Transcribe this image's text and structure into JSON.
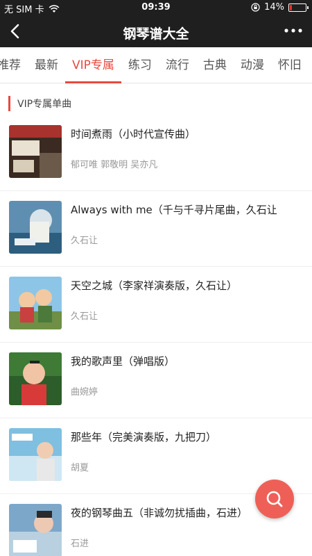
{
  "status_bar": {
    "carrier": "无 SIM 卡",
    "time": "09:39",
    "battery_text": "14%",
    "battery_level": 0.14,
    "battery_color": "#e33333"
  },
  "navbar": {
    "back_icon": "chevron-left-icon",
    "title": "钢琴谱大全",
    "more_icon": "more-horizontal-icon"
  },
  "tabs": [
    {
      "label": "推荐",
      "active": false
    },
    {
      "label": "最新",
      "active": false
    },
    {
      "label": "VIP专属",
      "active": true
    },
    {
      "label": "练习",
      "active": false
    },
    {
      "label": "流行",
      "active": false
    },
    {
      "label": "古典",
      "active": false
    },
    {
      "label": "动漫",
      "active": false
    },
    {
      "label": "怀旧",
      "active": false
    }
  ],
  "section": {
    "title": "VIP专属单曲"
  },
  "songs": [
    {
      "title": "时间煮雨（小时代宣传曲）",
      "artist": "郁可唯 郭敬明 吴亦凡"
    },
    {
      "title": "Always with me（千与千寻片尾曲，久石让",
      "artist": "久石让"
    },
    {
      "title": "天空之城（李家祥演奏版，久石让）",
      "artist": "久石让"
    },
    {
      "title": "我的歌声里（弹唱版）",
      "artist": "曲婉婷"
    },
    {
      "title": "那些年（完美演奏版，九把刀）",
      "artist": "胡夏"
    },
    {
      "title": "夜的钢琴曲五（非诚勿扰插曲，石进）",
      "artist": "石进"
    }
  ],
  "fab": {
    "icon": "search-icon",
    "color": "#ee6057"
  },
  "accent_color": "#e8483f"
}
